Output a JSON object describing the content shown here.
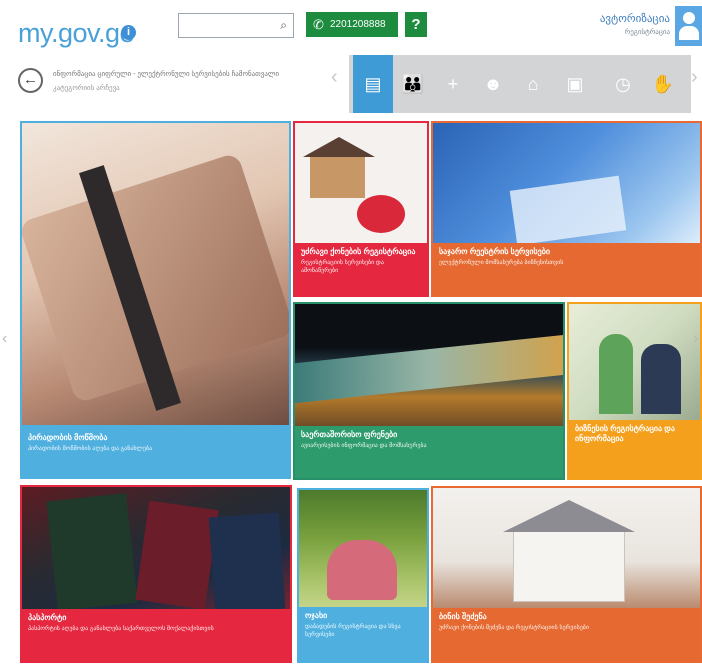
{
  "header": {
    "logo": "my.gov.ge",
    "logo_badge": "i",
    "search_placeholder": "",
    "phone": "2201208888",
    "help": "?",
    "user_name": "ავტორიზაცია",
    "user_sub": "რეგისტრაცია"
  },
  "breadcrumb": {
    "back": "←",
    "line1": "ინფორმაცია ციფრული - ელექტრონული სერვისების ჩამონათვალი",
    "line2": "კატეგორიის არჩევა"
  },
  "categories": {
    "prev": "‹",
    "next": "›",
    "items": [
      {
        "icon": "id-card-icon",
        "glyph": "▤",
        "active": true
      },
      {
        "icon": "family-icon",
        "glyph": "👪",
        "active": false
      },
      {
        "icon": "health-plus-icon",
        "glyph": "+",
        "active": false
      },
      {
        "icon": "people-icon",
        "glyph": "☻",
        "active": false
      },
      {
        "icon": "home-icon",
        "glyph": "⌂",
        "active": false
      },
      {
        "icon": "briefcase-icon",
        "glyph": "▣",
        "active": false
      },
      {
        "icon": "clock-icon",
        "glyph": "◷",
        "active": false
      },
      {
        "icon": "hand-icon",
        "glyph": "✋",
        "active": false
      }
    ]
  },
  "tiles": [
    {
      "title": "პირადობის მოწმობა",
      "subtitle": "პირადობის მოწმობის აღება და განახლება"
    },
    {
      "title": "უძრავი ქონების რეგისტრაცია",
      "subtitle": "რეგისტრაციის სერვისები და ამონაწერები"
    },
    {
      "title": "საჯარო რეესტრის სერვისები",
      "subtitle": "ელექტრონული მომსახურება ბიზნესისთვის"
    },
    {
      "title": "საერთაშორისო ფრენები",
      "subtitle": "ავიარეისების ინფორმაცია და მომსახურება"
    },
    {
      "title": "ბიზნესის რეგისტრაცია და ინფორმაცია",
      "subtitle": ""
    },
    {
      "title": "პასპორტი",
      "subtitle": "პასპორტის აღება და განახლება საქართველოს მოქალაქისთვის"
    },
    {
      "title": "ოჯახი",
      "subtitle": "დაბადების რეგისტრაცია და სხვა სერვისები"
    },
    {
      "title": "ბინის შეძენა",
      "subtitle": "უძრავი ქონების შეძენა და რეგისტრაციის სერვისები"
    }
  ],
  "colors": {
    "accent_blue": "#4fb0df",
    "red": "#e5283f",
    "orange": "#e56931",
    "green": "#2e9b6c",
    "amber": "#f4a01d",
    "phone_green": "#1d8c3f"
  }
}
